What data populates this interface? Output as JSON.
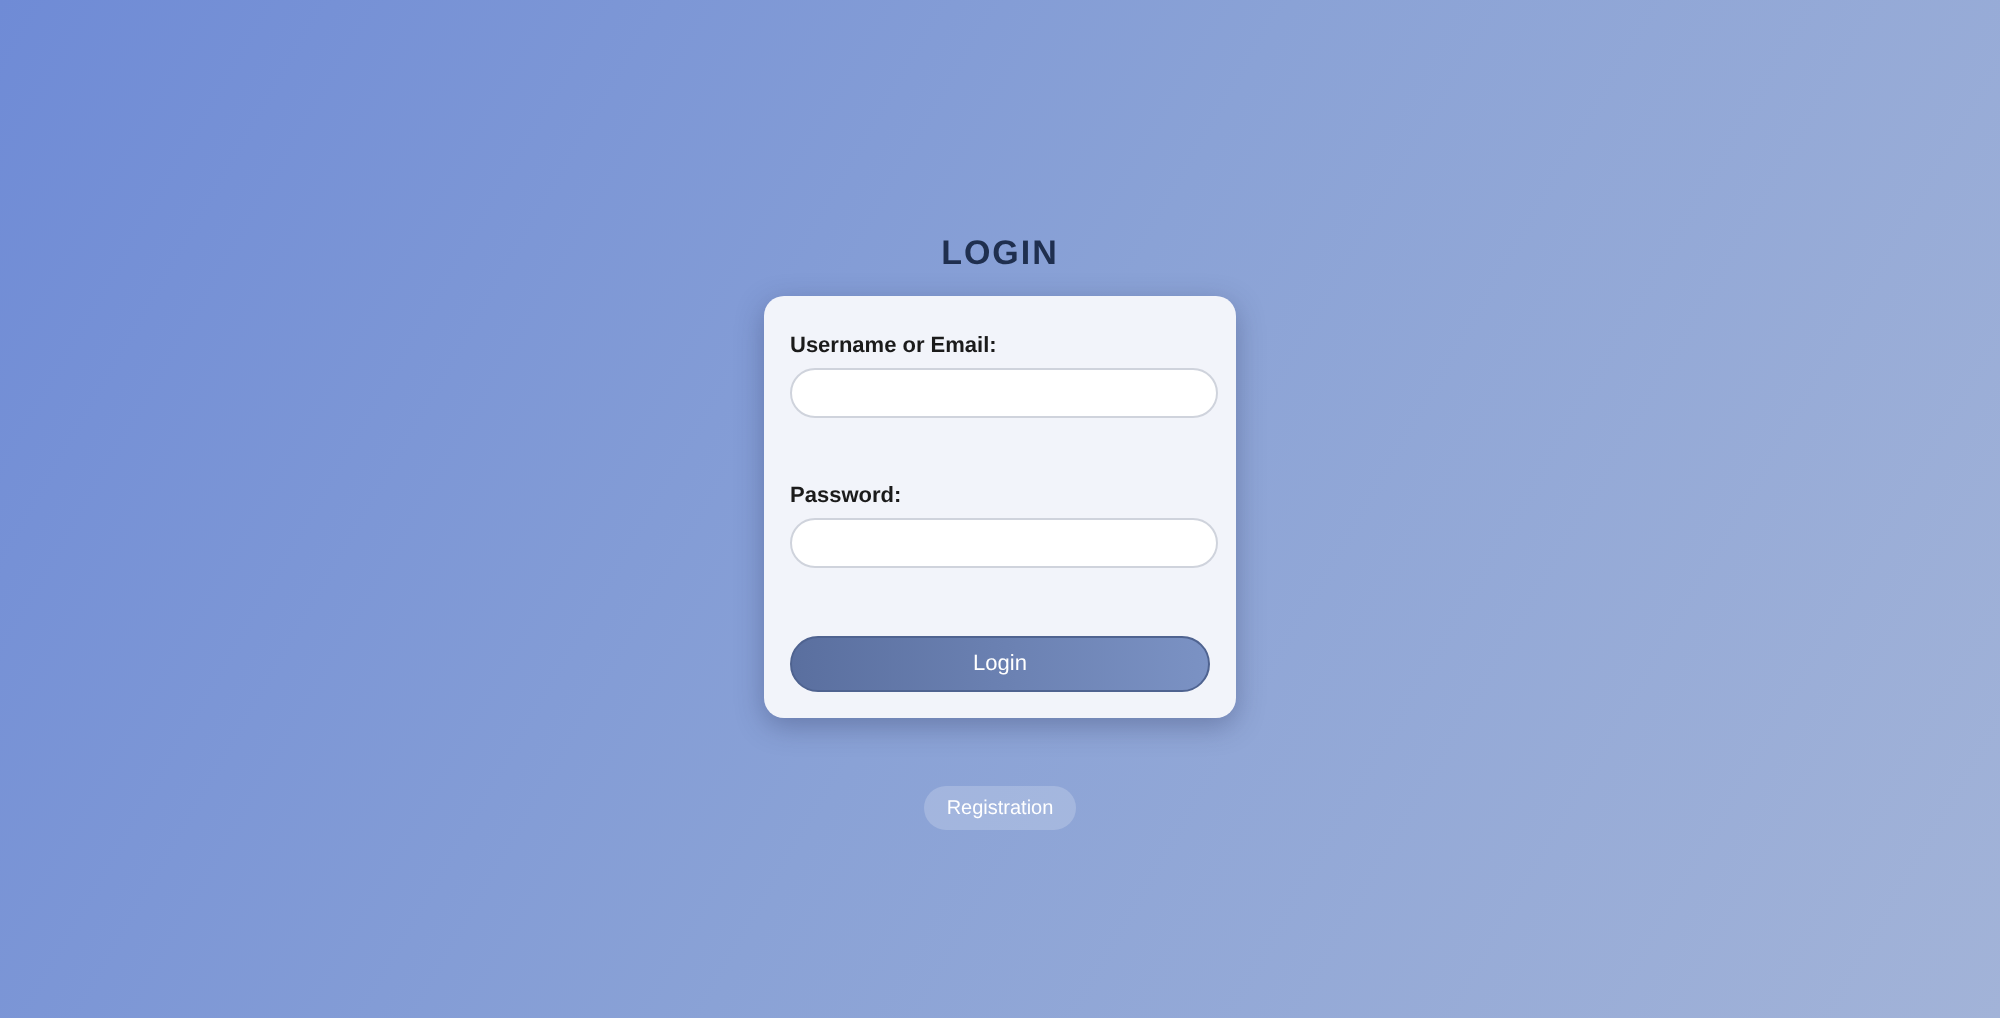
{
  "title": "LOGIN",
  "form": {
    "fields": [
      {
        "label": "Username or Email:"
      },
      {
        "label": "Password:"
      }
    ],
    "submit": "Login"
  },
  "registration": "Registration"
}
